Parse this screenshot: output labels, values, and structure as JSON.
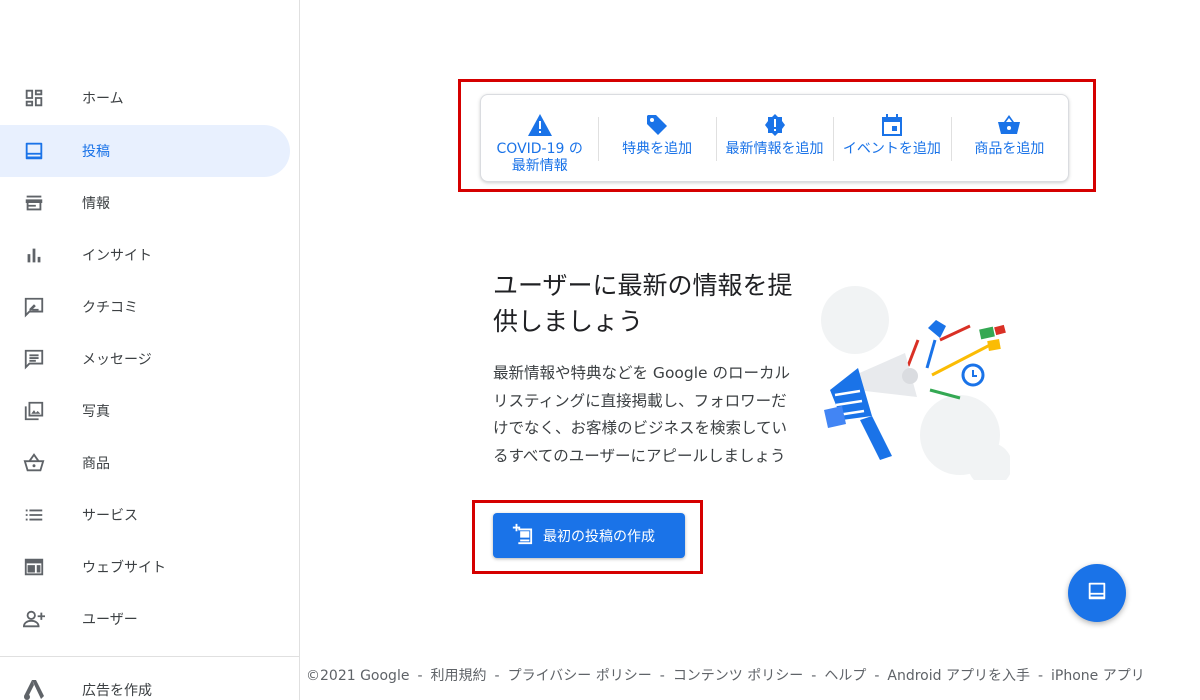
{
  "sidebar": {
    "items": [
      {
        "label": "ホーム",
        "icon": "dashboard-icon"
      },
      {
        "label": "投稿",
        "icon": "post-icon",
        "active": true
      },
      {
        "label": "情報",
        "icon": "store-icon"
      },
      {
        "label": "インサイト",
        "icon": "bar-chart-icon"
      },
      {
        "label": "クチコミ",
        "icon": "review-icon"
      },
      {
        "label": "メッセージ",
        "icon": "message-icon"
      },
      {
        "label": "写真",
        "icon": "photo-icon"
      },
      {
        "label": "商品",
        "icon": "basket-icon"
      },
      {
        "label": "サービス",
        "icon": "list-icon"
      },
      {
        "label": "ウェブサイト",
        "icon": "website-icon"
      },
      {
        "label": "ユーザー",
        "icon": "add-user-icon"
      },
      {
        "label": "広告を作成",
        "icon": "ads-icon"
      }
    ]
  },
  "actions": [
    {
      "label": "COVID-19 の最新情報",
      "icon": "warning-icon"
    },
    {
      "label": "特典を追加",
      "icon": "tag-icon"
    },
    {
      "label": "最新情報を追加",
      "icon": "badge-alert-icon"
    },
    {
      "label": "イベントを追加",
      "icon": "calendar-icon"
    },
    {
      "label": "商品を追加",
      "icon": "basket-icon"
    }
  ],
  "main": {
    "headline": "ユーザーに最新の情報を提供しましょう",
    "body": "最新情報や特典などを Google のローカル リスティングに直接掲載し、フォロワーだけでなく、お客様のビジネスを検索しているすべてのユーザーにアピールしましょう",
    "cta_label": "最初の投稿の作成"
  },
  "footer": {
    "copyright": "©2021 Google",
    "links": [
      "利用規約",
      "プライバシー ポリシー",
      "コンテンツ ポリシー",
      "ヘルプ",
      "Android アプリを入手",
      "iPhone アプリ"
    ],
    "separator": "-"
  },
  "colors": {
    "accent": "#1a73e8",
    "highlight": "#d50000",
    "active_bg": "#e8f0fe"
  }
}
